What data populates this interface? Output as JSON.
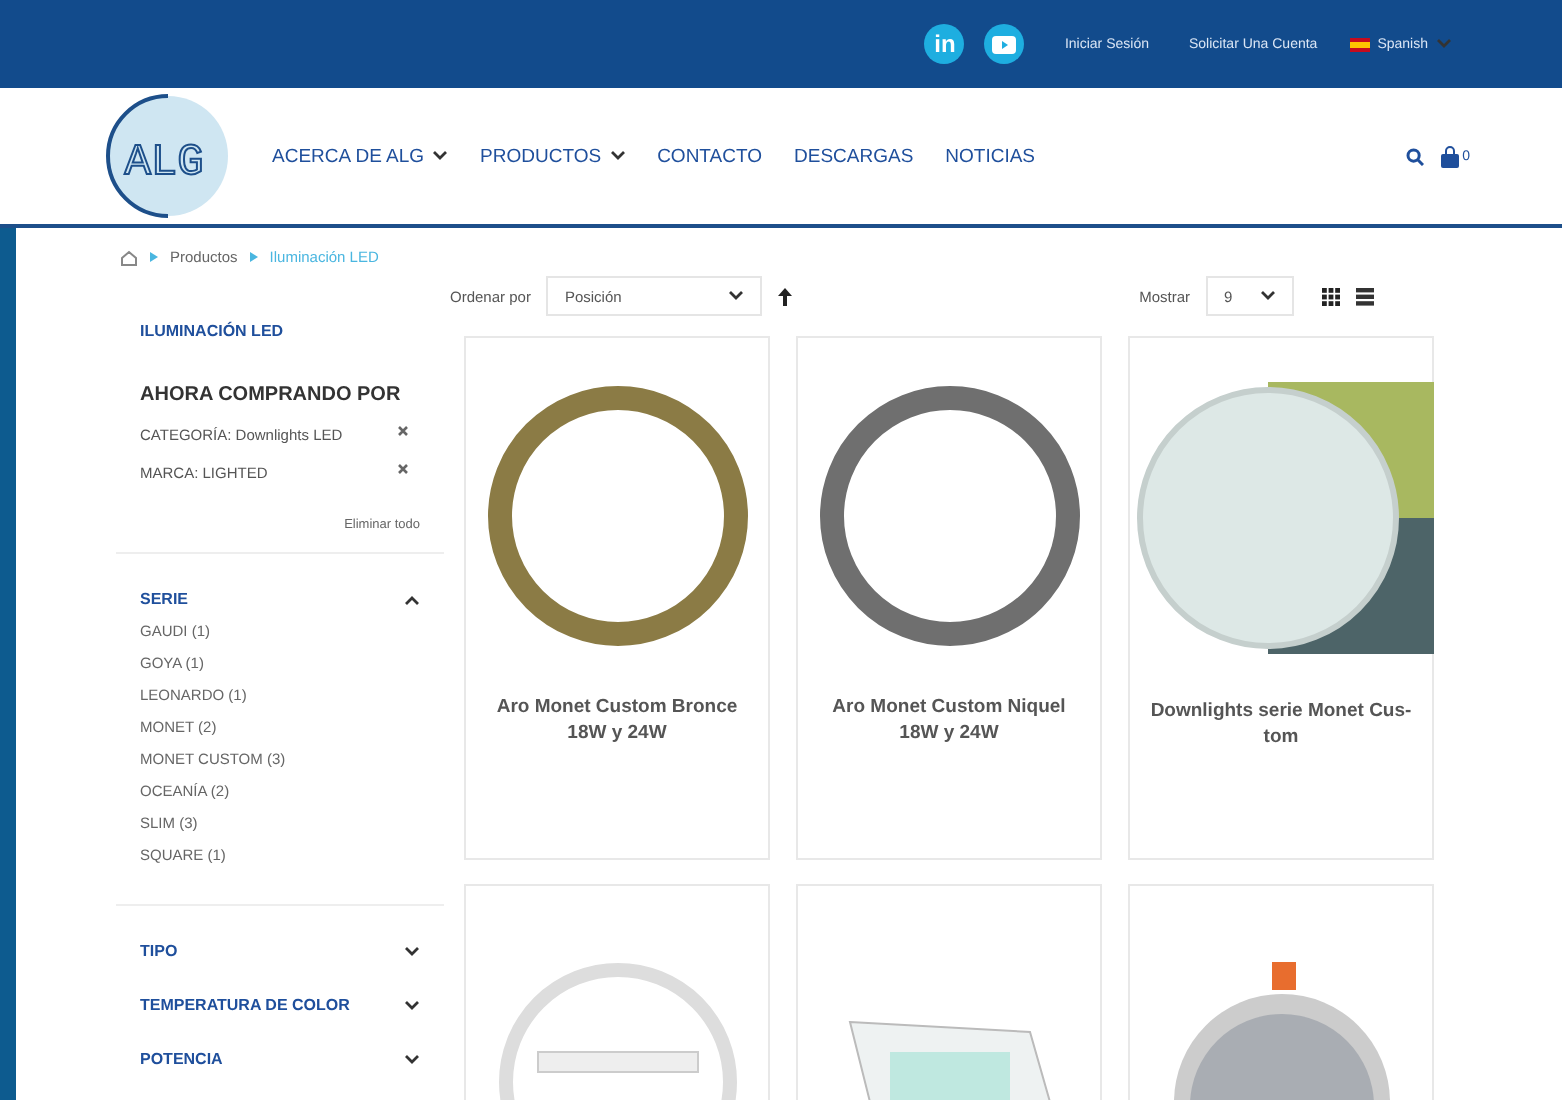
{
  "top_bar": {
    "social": [
      {
        "label": "in"
      }
    ],
    "links": [
      "Iniciar Sesión",
      "Solicitar Una Cuenta"
    ],
    "language": "Spanish"
  },
  "header": {
    "logo": "ALG",
    "nav": [
      {
        "label": "ACERCA DE ALG",
        "dropdown": true
      },
      {
        "label": "PRODUCTOS",
        "dropdown": true
      },
      {
        "label": "CONTACTO",
        "dropdown": false
      },
      {
        "label": "DESCARGAS",
        "dropdown": false
      },
      {
        "label": "NOTICIAS",
        "dropdown": false
      }
    ],
    "cart_count": "0"
  },
  "breadcrumb": [
    "Productos",
    "Iluminación LED"
  ],
  "sidebar": {
    "category": "ILUMINACIÓN LED",
    "filters_title": "AHORA COMPRANDO POR",
    "active_filters": [
      {
        "name": "CATEGORÍA:",
        "value": "Downlights LED"
      },
      {
        "name": "MARCA:",
        "value": "LIGHTED"
      }
    ],
    "clear_all": "Eliminar todo",
    "groups": [
      {
        "title": "SERIE",
        "expanded": true,
        "items": [
          "GAUDI (1)",
          "GOYA (1)",
          "LEONARDO (1)",
          "MONET (2)",
          "MONET CUSTOM (3)",
          "OCEANÍA (2)",
          "SLIM (3)",
          "SQUARE (1)"
        ]
      },
      {
        "title": "TIPO",
        "expanded": false
      },
      {
        "title": "TEMPERATURA DE COLOR",
        "expanded": false
      },
      {
        "title": "POTENCIA",
        "expanded": false
      }
    ]
  },
  "toolbar": {
    "sort_label": "Ordenar por",
    "sort_value": "Posición",
    "show_label": "Mostrar",
    "show_value": "9"
  },
  "products": [
    {
      "kind": "bronze",
      "name": "Aro Monet Custom Bronce 18W y 24W"
    },
    {
      "kind": "nickel",
      "name": "Aro Monet Custom Niquel 18W y 24W"
    },
    {
      "kind": "panel",
      "name": "Downlights serie Monet Cus-tom"
    },
    {
      "kind": "surface"
    },
    {
      "kind": "square"
    },
    {
      "kind": "downlight"
    }
  ]
}
